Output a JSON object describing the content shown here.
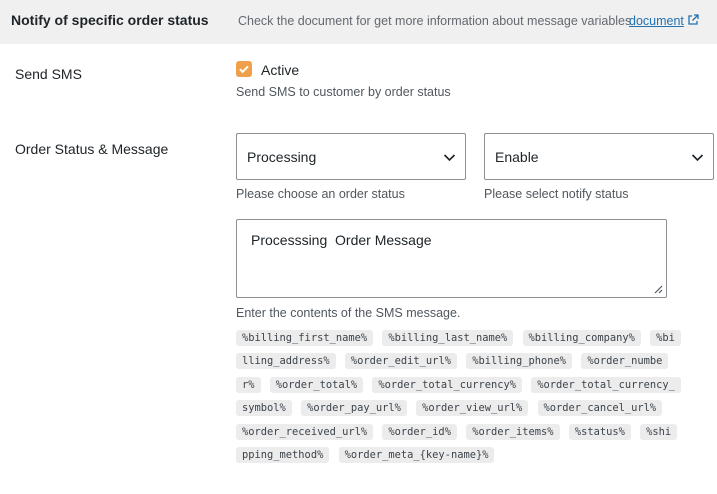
{
  "header": {
    "title": "Notify of specific order status",
    "description": "Check the document for get more information about message variables",
    "link_label": "document"
  },
  "send_sms": {
    "label": "Send SMS",
    "checkbox_label": "Active",
    "checked": true,
    "help": "Send SMS to customer by order status"
  },
  "order_status": {
    "label": "Order Status & Message",
    "status_select": {
      "value": "Processing",
      "help": "Please choose an order status"
    },
    "notify_select": {
      "value": "Enable",
      "help": "Please select notify status"
    },
    "message": {
      "value": "Processsing  Order Message",
      "help": "Enter the contents of the SMS message."
    }
  },
  "variables": [
    "%billing_first_name%",
    "%billing_last_name%",
    "%billing_company%",
    "%billing_address%",
    "%order_edit_url%",
    "%billing_phone%",
    "%order_number%",
    "%order_total%",
    "%order_total_currency%",
    "%order_total_currency_symbol%",
    "%order_pay_url%",
    "%order_view_url%",
    "%order_cancel_url%",
    "%order_received_url%",
    "%order_id%",
    "%order_items%",
    "%status%",
    "%shipping_method%",
    "%order_meta_{key-name}%"
  ],
  "colors": {
    "header_bg": "#f0f0f1",
    "link": "#2271b1",
    "checkbox": "#f0a04b",
    "tag_bg": "#ececec"
  },
  "icons": {
    "external_link": "external-link-icon",
    "check": "check-icon",
    "chevron": "chevron-down-icon"
  }
}
